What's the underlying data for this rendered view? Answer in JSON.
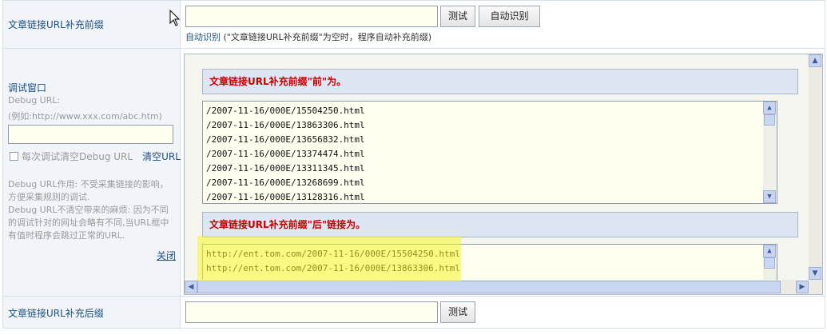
{
  "prefix_row": {
    "label": "文章链接URL补充前缀",
    "input_value": "",
    "test_button": "测试",
    "auto_button": "自动识别",
    "auto_link": "自动识别",
    "hint": " (\"文章链接URL补充前缀\"为空时，程序自动补充前缀)"
  },
  "debug_row": {
    "title": "调试窗口",
    "debug_url_label": "Debug URL:",
    "debug_url_example": "(例如:http://www.xxx.com/abc.htm)",
    "debug_url_value": "",
    "clear_checkbox_label": "每次调试清空Debug URL",
    "clear_url_link": "清空URL",
    "help_text": "Debug URL作用: 不受采集链接的影响，方便采集规则的调试.\nDebug URL不清空带来的麻烦: 因为不同的调试针对的网址会略有不同,当URL框中有值时程序会跳过正常的URL.",
    "close_link": "关闭",
    "before_header": "文章链接URL补充前缀\"前\"为。",
    "before_lines": [
      "/2007-11-16/000E/15504250.html",
      "/2007-11-16/000E/13863306.html",
      "/2007-11-16/000E/13656832.html",
      "/2007-11-16/000E/13374474.html",
      "/2007-11-16/000E/13311345.html",
      "/2007-11-16/000E/13268699.html",
      "/2007-11-16/000E/13128316.html"
    ],
    "after_header": "文章链接URL补充前缀\"后\"链接为。",
    "after_lines": [
      "http://ent.tom.com/2007-11-16/000E/15504250.html",
      "http://ent.tom.com/2007-11-16/000E/13863306.html"
    ]
  },
  "suffix_row": {
    "label": "文章链接URL补充后缀",
    "input_value": "",
    "test_button": "测试"
  },
  "colors": {
    "label_blue": "#1c4f83",
    "header_red": "#c40000",
    "highlight_yellow": "#f5f528"
  }
}
